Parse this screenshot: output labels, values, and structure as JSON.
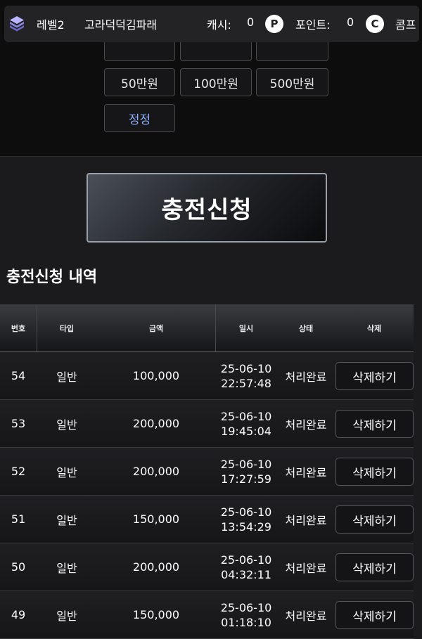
{
  "topbar": {
    "level": "레벨2",
    "username": "고라덕덕김파래",
    "cash_label": "캐시:",
    "cash_value": "0",
    "point_label": "포인트:",
    "point_value": "0",
    "comp_label": "콤프",
    "point_icon_letter": "P",
    "comp_icon_letter": "C"
  },
  "amounts": {
    "row2": [
      "50만원",
      "100만원",
      "500만원"
    ],
    "reset": "정정"
  },
  "apply_button": "충전신청",
  "history": {
    "title": "충전신청 내역",
    "columns": [
      "번호",
      "타입",
      "금액",
      "일시",
      "상태",
      "삭제"
    ],
    "rows": [
      {
        "no": "54",
        "type": "일반",
        "amount": "100,000",
        "date": "25-06-10",
        "time": "22:57:48",
        "status": "처리완료",
        "action": "삭제하기"
      },
      {
        "no": "53",
        "type": "일반",
        "amount": "200,000",
        "date": "25-06-10",
        "time": "19:45:04",
        "status": "처리완료",
        "action": "삭제하기"
      },
      {
        "no": "52",
        "type": "일반",
        "amount": "200,000",
        "date": "25-06-10",
        "time": "17:27:59",
        "status": "처리완료",
        "action": "삭제하기"
      },
      {
        "no": "51",
        "type": "일반",
        "amount": "150,000",
        "date": "25-06-10",
        "time": "13:54:29",
        "status": "처리완료",
        "action": "삭제하기"
      },
      {
        "no": "50",
        "type": "일반",
        "amount": "200,000",
        "date": "25-06-10",
        "time": "04:32:11",
        "status": "처리완료",
        "action": "삭제하기"
      },
      {
        "no": "49",
        "type": "일반",
        "amount": "150,000",
        "date": "25-06-10",
        "time": "01:18:10",
        "status": "처리완료",
        "action": "삭제하기"
      }
    ]
  }
}
